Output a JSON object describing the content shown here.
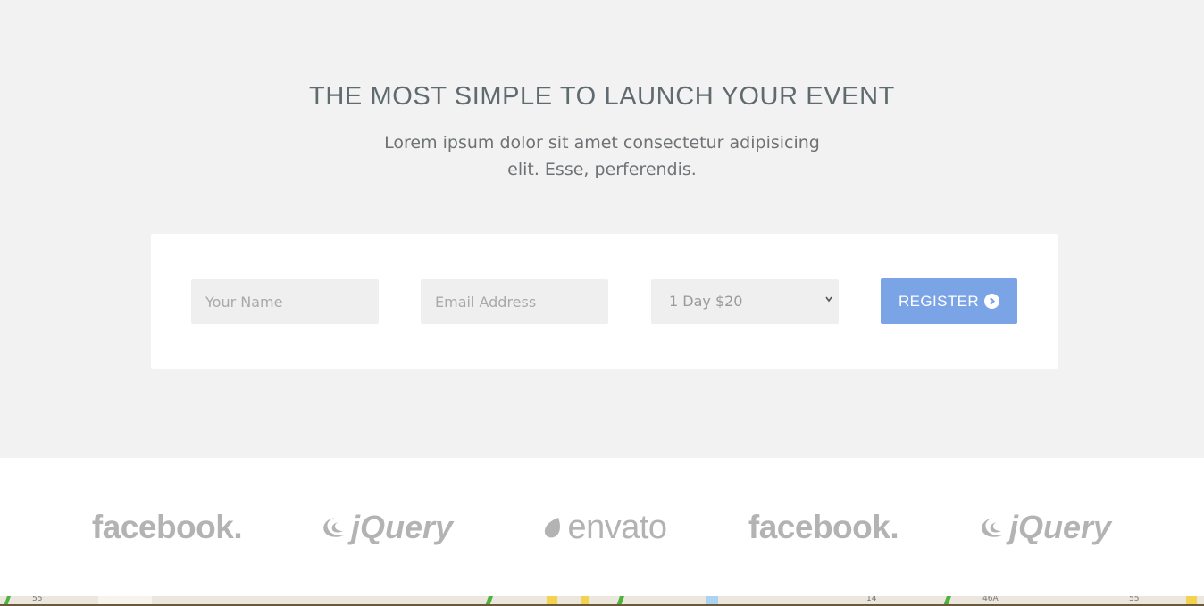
{
  "hero": {
    "title": "THE MOST SIMPLE TO LAUNCH YOUR EVENT",
    "subtitle_line1": "Lorem ipsum dolor sit amet consectetur adipisicing",
    "subtitle_line2": "elit. Esse, perferendis."
  },
  "form": {
    "name_placeholder": "Your Name",
    "email_placeholder": "Email Address",
    "ticket_selected": "1 Day $20",
    "register_label": "REGISTER"
  },
  "logos": [
    {
      "name": "facebook",
      "text": "facebook."
    },
    {
      "name": "jquery",
      "text": "jQuery"
    },
    {
      "name": "envato",
      "text": "envato"
    },
    {
      "name": "facebook",
      "text": "facebook."
    },
    {
      "name": "jquery",
      "text": "jQuery"
    }
  ],
  "map_labels": [
    "55",
    "14",
    "46A",
    "55"
  ],
  "colors": {
    "hero_bg": "#f2f2f2",
    "accent": "#7ba4e6",
    "logo_gray": "#b3b3b3",
    "title_text": "#5f6b6e"
  }
}
